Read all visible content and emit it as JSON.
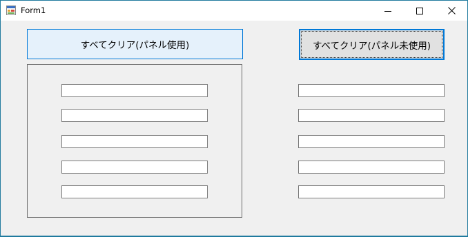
{
  "window": {
    "title": "Form1",
    "accent_color": "#0078d7"
  },
  "titlebar": {
    "icons": [
      "app-form-icon",
      "minimize-icon",
      "maximize-icon",
      "close-icon"
    ]
  },
  "buttons": {
    "clear_with_panel": "すべてクリア(パネル使用)",
    "clear_without_panel": "すべてクリア(パネル未使用)"
  },
  "panel_textboxes": [
    {
      "value": ""
    },
    {
      "value": ""
    },
    {
      "value": ""
    },
    {
      "value": ""
    },
    {
      "value": ""
    }
  ],
  "standalone_textboxes": [
    {
      "value": ""
    },
    {
      "value": ""
    },
    {
      "value": ""
    },
    {
      "value": ""
    },
    {
      "value": ""
    }
  ]
}
